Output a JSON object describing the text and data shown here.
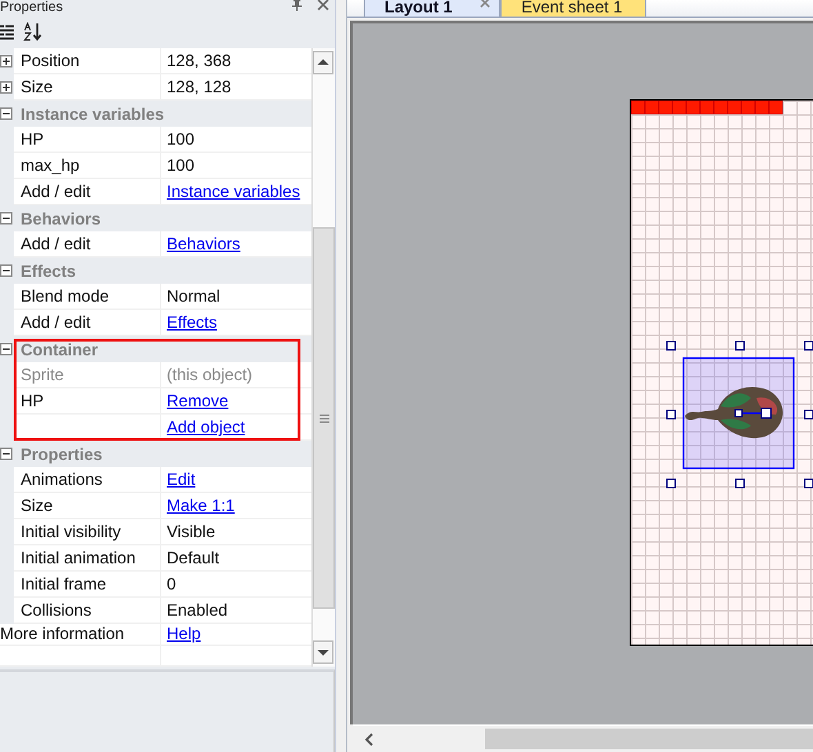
{
  "panel": {
    "title": "Properties",
    "sections": [
      {
        "highlighted": false,
        "rows": [
          {
            "name": "Position",
            "value": "128, 368",
            "kind": "text",
            "expanded": false,
            "disabled": false
          },
          {
            "name": "Size",
            "value": "128, 128",
            "kind": "text",
            "expanded": false,
            "disabled": false
          }
        ]
      },
      {
        "title": "Instance variables",
        "expanded": true,
        "highlighted": false,
        "rows": [
          {
            "name": "HP",
            "value": "100",
            "kind": "text",
            "disabled": false
          },
          {
            "name": "max_hp",
            "value": "100",
            "kind": "text",
            "disabled": false
          },
          {
            "name": "Add / edit",
            "value": "Instance variables",
            "kind": "link",
            "disabled": false
          }
        ]
      },
      {
        "title": "Behaviors",
        "expanded": true,
        "highlighted": false,
        "rows": [
          {
            "name": "Add / edit",
            "value": "Behaviors",
            "kind": "link",
            "disabled": false
          }
        ]
      },
      {
        "title": "Effects",
        "expanded": true,
        "highlighted": false,
        "rows": [
          {
            "name": "Blend mode",
            "value": "Normal",
            "kind": "text",
            "disabled": false
          },
          {
            "name": "Add / edit",
            "value": "Effects",
            "kind": "link",
            "disabled": false
          }
        ]
      },
      {
        "title": "Container",
        "expanded": true,
        "highlighted": true,
        "rows": [
          {
            "name": "Sprite",
            "value": "(this object)",
            "kind": "text",
            "disabled": true
          },
          {
            "name": "HP",
            "value": "Remove",
            "kind": "link",
            "disabled": false
          },
          {
            "value": "Add object",
            "kind": "link",
            "disabled": false
          }
        ]
      },
      {
        "title": "Properties",
        "expanded": true,
        "highlighted": false,
        "rows": [
          {
            "name": "Animations",
            "value": "Edit",
            "kind": "link",
            "disabled": false
          },
          {
            "name": "Size",
            "value": "Make 1:1",
            "kind": "link",
            "disabled": false
          },
          {
            "name": "Initial visibility",
            "value": "Visible",
            "kind": "text",
            "disabled": false
          },
          {
            "name": "Initial animation",
            "value": "Default",
            "kind": "text",
            "disabled": false
          },
          {
            "name": "Initial frame",
            "value": "0",
            "kind": "text",
            "disabled": false
          },
          {
            "name": "Collisions",
            "value": "Enabled",
            "kind": "text",
            "disabled": false
          }
        ]
      }
    ],
    "footer_rows": [
      {
        "name": "More information",
        "value": "Help",
        "kind": "link"
      }
    ]
  },
  "tabs": [
    {
      "label": "Layout 1",
      "selected": true,
      "closable": true
    },
    {
      "label": "Event sheet 1",
      "selected": false,
      "closable": false
    }
  ]
}
